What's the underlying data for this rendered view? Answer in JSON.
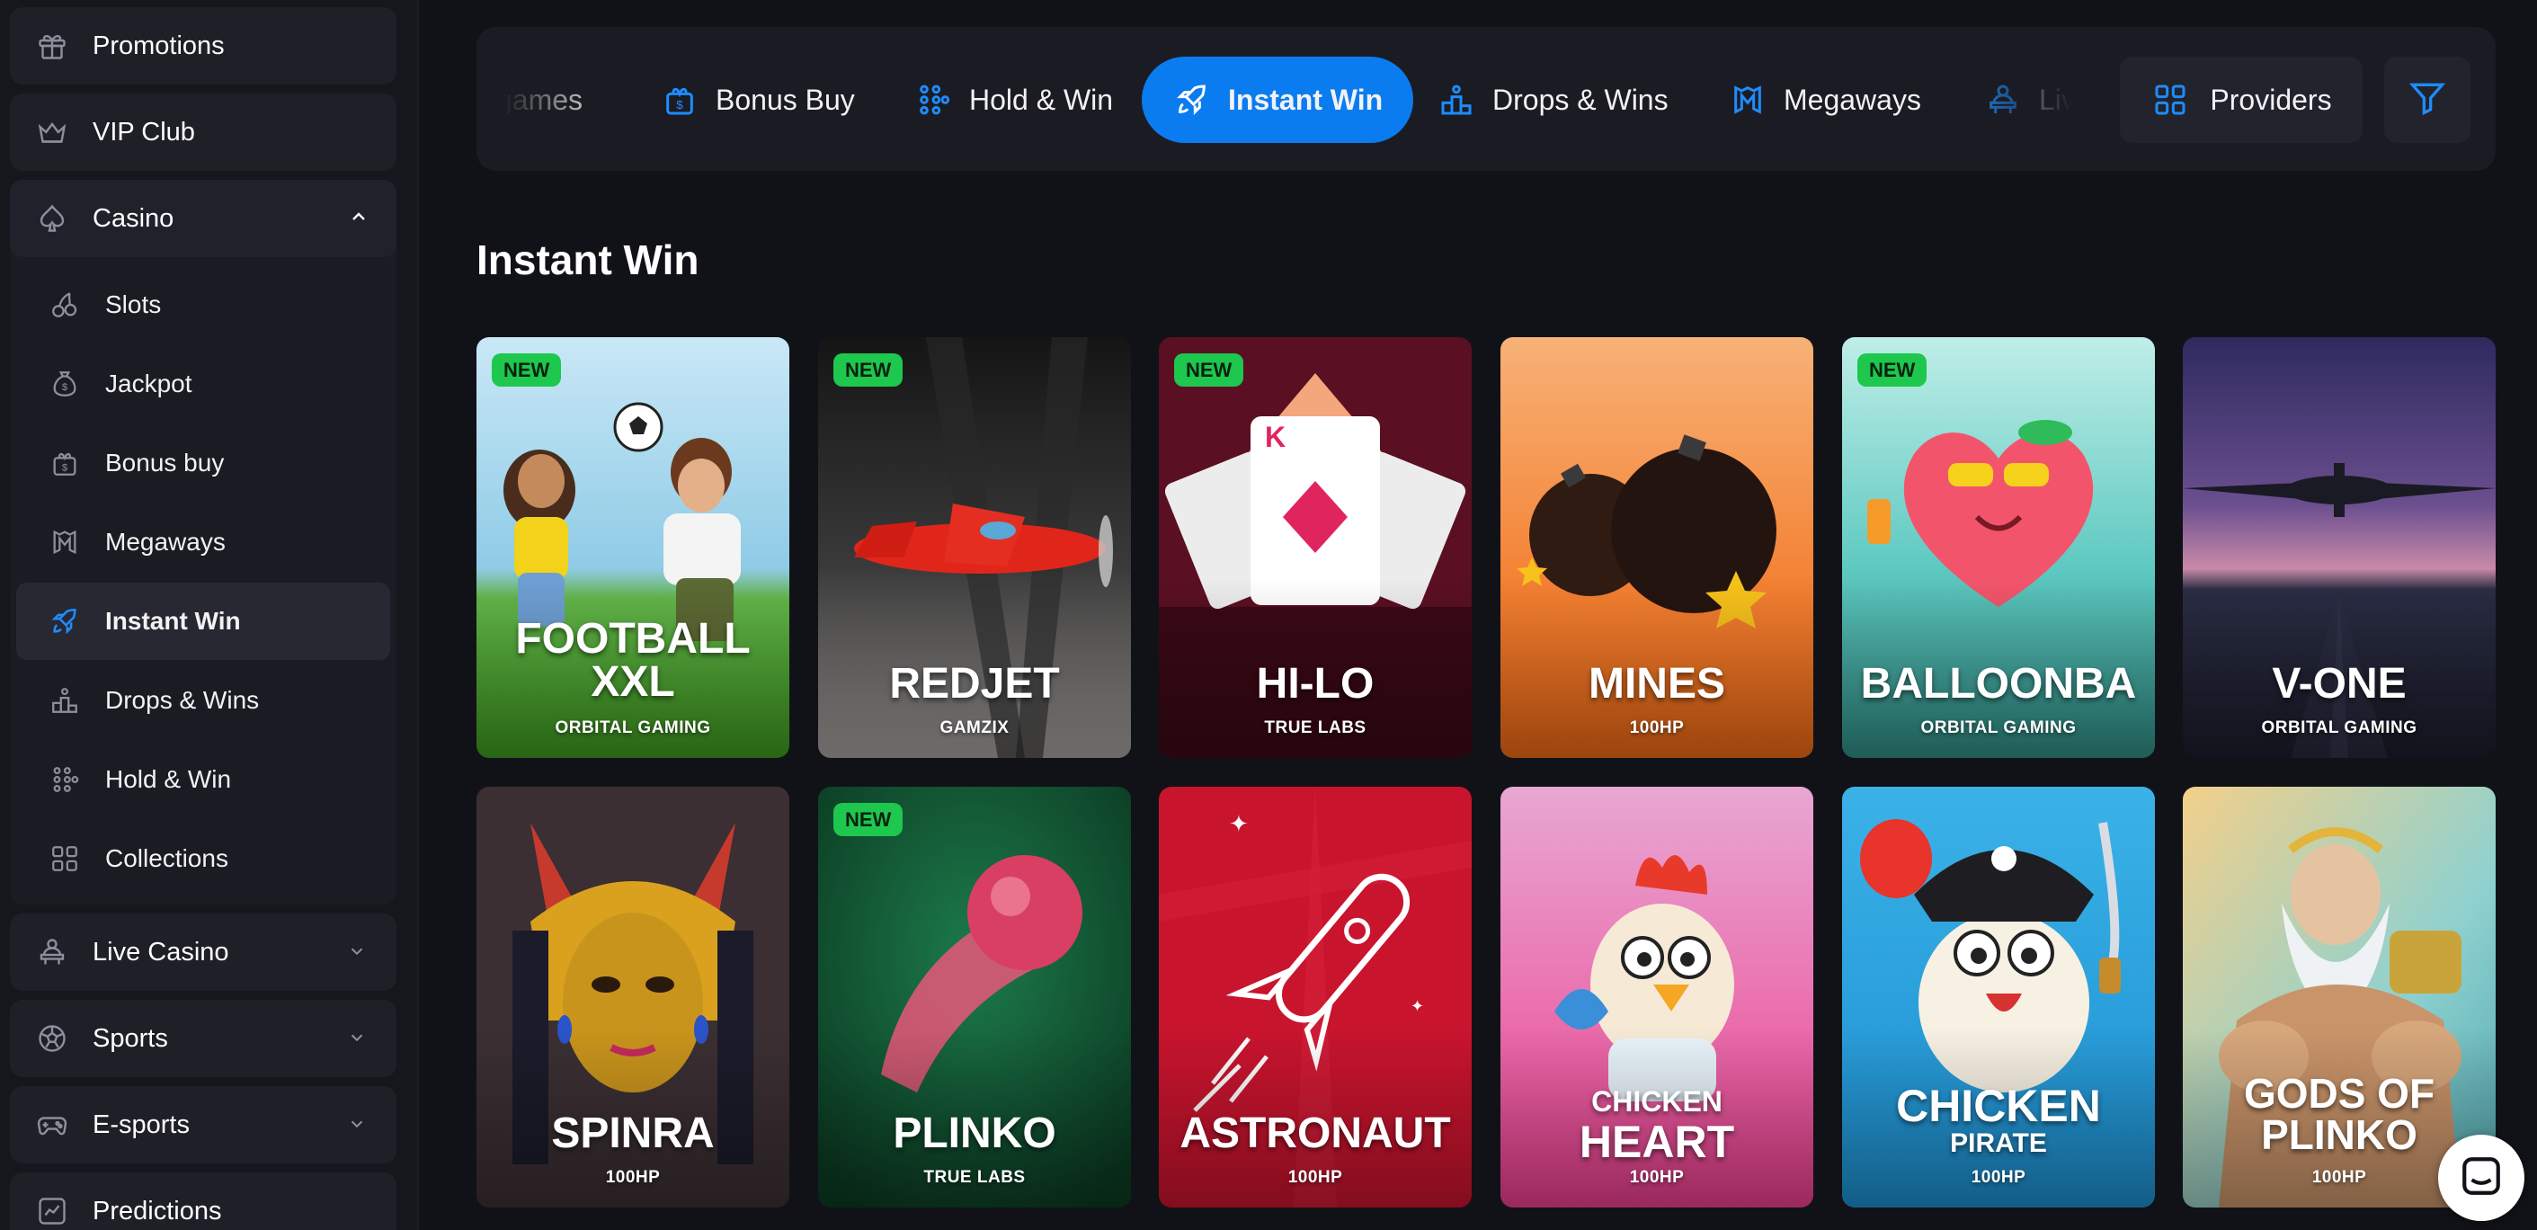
{
  "sidebar": {
    "promotions": "Promotions",
    "vip": "VIP Club",
    "casino": "Casino",
    "casino_items": [
      "Slots",
      "Jackpot",
      "Bonus buy",
      "Megaways",
      "Instant Win",
      "Drops & Wins",
      "Hold & Win",
      "Collections"
    ],
    "live_casino": "Live Casino",
    "sports": "Sports",
    "esports": "E-sports",
    "predictions": "Predictions"
  },
  "topbar": {
    "tabs": [
      "games",
      "Bonus Buy",
      "Hold & Win",
      "Instant Win",
      "Drops & Wins",
      "Megaways",
      "Live"
    ],
    "active_tab": "Instant Win",
    "providers": "Providers"
  },
  "page_title": "Instant Win",
  "new_badge": "NEW",
  "games": [
    {
      "title_lines": [
        "FOOTBALL",
        "XXL"
      ],
      "provider": "ORBITAL GAMING",
      "is_new": true
    },
    {
      "title_lines": [
        "REDJET"
      ],
      "provider": "GAMZIX",
      "is_new": true
    },
    {
      "title_lines": [
        "HI-LO"
      ],
      "provider": "TRUE LABS",
      "is_new": true
    },
    {
      "title_lines": [
        "MINES"
      ],
      "provider": "100HP",
      "is_new": false
    },
    {
      "title_lines": [
        "BALLOONBA"
      ],
      "provider": "ORBITAL GAMING",
      "is_new": true
    },
    {
      "title_lines": [
        "V-ONE"
      ],
      "provider": "ORBITAL GAMING",
      "is_new": false
    },
    {
      "title_lines": [
        "SPINRA"
      ],
      "provider": "100HP",
      "is_new": false
    },
    {
      "title_lines": [
        "PLINKO"
      ],
      "provider": "TRUE LABS",
      "is_new": true
    },
    {
      "title_lines": [
        "ASTRONAUT"
      ],
      "provider": "100HP",
      "is_new": false
    },
    {
      "title_lines": [
        "CHICKEN",
        "HEART"
      ],
      "provider": "100HP",
      "is_new": false
    },
    {
      "title_lines": [
        "CHICKEN",
        "PIRATE"
      ],
      "provider": "100HP",
      "is_new": false
    },
    {
      "title_lines": [
        "GODS OF",
        "PLINKO"
      ],
      "provider": "100HP",
      "is_new": false
    }
  ],
  "colors": {
    "accent": "#0a7cf0",
    "new_badge": "#1ec74d",
    "background": "#111217",
    "panel": "#1b1c23"
  },
  "icons": {
    "promotions": "gift-icon",
    "vip": "crown-icon",
    "casino": "spade-icon",
    "filter": "funnel-icon",
    "chat": "chat-icon"
  }
}
